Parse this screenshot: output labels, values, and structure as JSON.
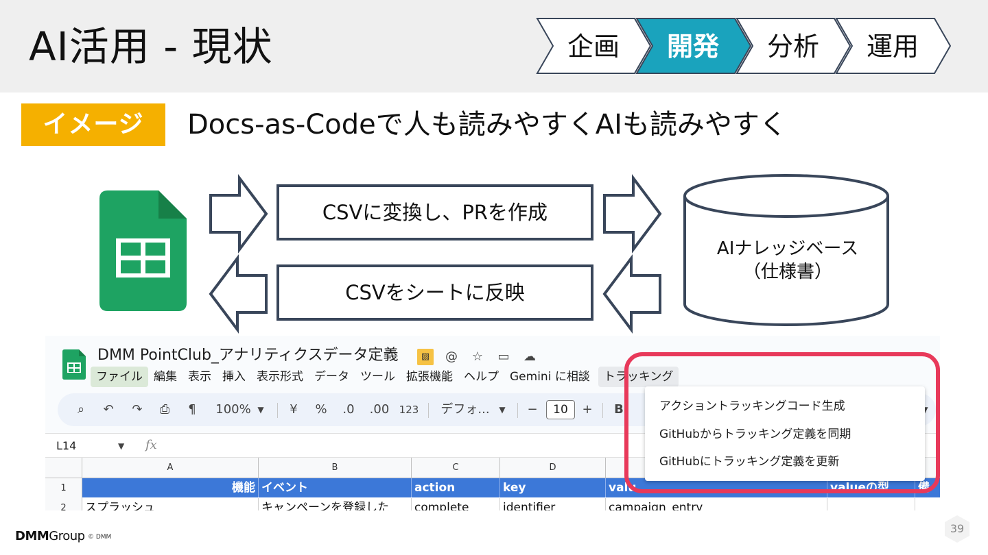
{
  "slide": {
    "title": "AI活用 - 現状",
    "badge": "イメージ",
    "subtitle": "Docs-as-Codeで人も読みやすくAIも読みやすく",
    "page_number": "39"
  },
  "phases": {
    "items": [
      "企画",
      "開発",
      "分析",
      "運用"
    ],
    "active": "開発",
    "active_color": "#1aa3bd"
  },
  "diagram": {
    "export_box": "CSVに変換し、PRを作成",
    "import_box": "CSVをシートに反映",
    "database_line1": "AIナレッジベース",
    "database_line2": "（仕様書）",
    "sheets_icon": "google-sheets-icon"
  },
  "spreadsheet": {
    "doc_title": "DMM PointClub_アナリティクスデータ定義",
    "menu": [
      "ファイル",
      "編集",
      "表示",
      "挿入",
      "表示形式",
      "データ",
      "ツール",
      "拡張機能",
      "ヘルプ",
      "Gemini に相談",
      "トラッキング"
    ],
    "toolbar": {
      "zoom": "100%",
      "currency": "¥",
      "percent": "%",
      "decrease_decimal": ".0",
      "increase_decimal": ".00",
      "number_format": "123",
      "font": "デフォ...",
      "font_size": "10",
      "minus": "−",
      "plus": "+",
      "bold": "B"
    },
    "name_box": "L14",
    "fx": "fx",
    "columns": [
      "A",
      "B",
      "C",
      "D"
    ],
    "rows": [
      {
        "num": "1",
        "cells": [
          "機能",
          "イベント",
          "action",
          "key",
          "valu",
          "valueの型",
          "備"
        ]
      },
      {
        "num": "2",
        "cells": [
          "スプラッシュ",
          "キャンペーンを登録した",
          "complete",
          "identifier",
          "campaign_entry",
          "",
          ""
        ]
      }
    ],
    "dropdown": [
      "アクショントラッキングコード生成",
      "GitHubからトラッキング定義を同期",
      "GitHubにトラッキング定義を更新"
    ],
    "highlight_color": "#e8395a"
  },
  "footer": {
    "logo": "DMM",
    "logo_suffix": "Group",
    "copyright": "© DMM"
  }
}
